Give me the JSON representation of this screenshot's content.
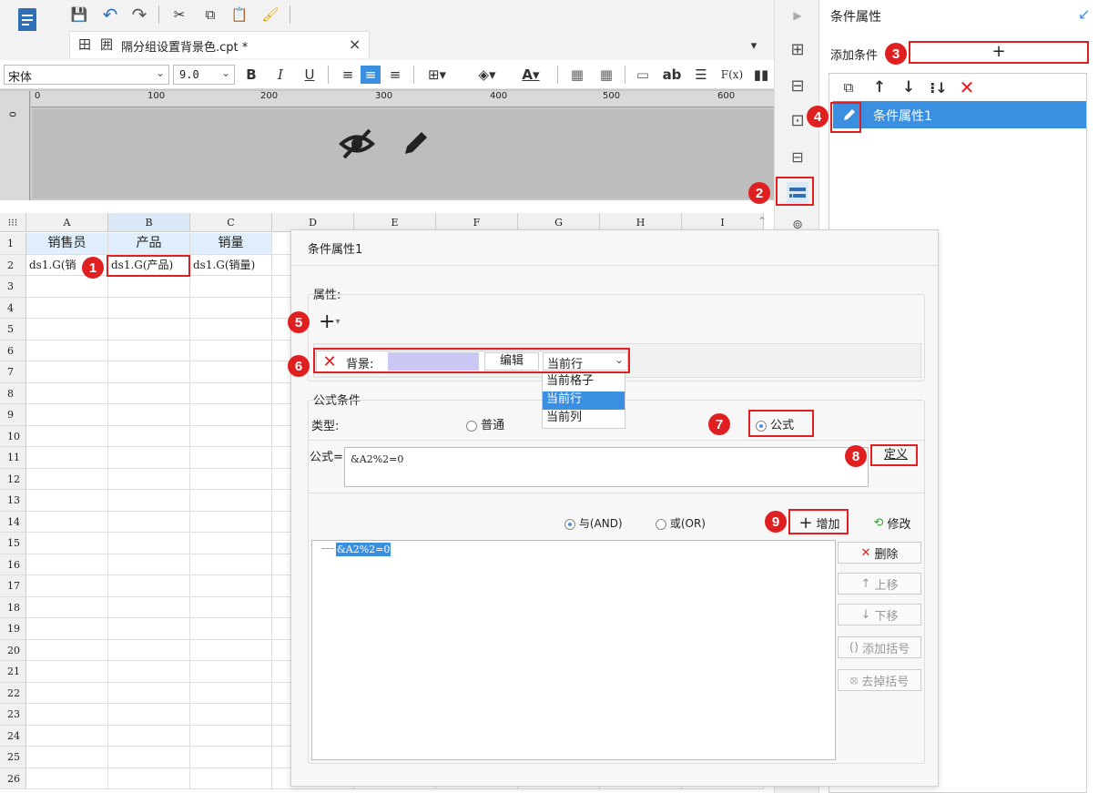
{
  "toolbar": {
    "file_title": "隔分组设置背景色.cpt *",
    "font_name": "宋体",
    "font_size": "9.0",
    "bold": "B",
    "italic": "I",
    "underline": "U",
    "text_btn": "ab",
    "formula_btn": "F(x)",
    "close": "×"
  },
  "ruler": {
    "ticks": [
      "0",
      "100",
      "200",
      "300",
      "400",
      "500",
      "600"
    ],
    "v_zero": "0"
  },
  "grid": {
    "columns": [
      "A",
      "B",
      "C",
      "D",
      "E",
      "F",
      "G",
      "H",
      "I"
    ],
    "rows": [
      "1",
      "2",
      "3",
      "4",
      "5",
      "6",
      "7",
      "8",
      "9",
      "10",
      "11",
      "12",
      "13",
      "14",
      "15",
      "16",
      "17",
      "18",
      "19",
      "20",
      "21",
      "22",
      "23",
      "24",
      "25",
      "26"
    ],
    "header_row": [
      "销售员",
      "产品",
      "销量"
    ],
    "data_row": [
      "ds1.G(销",
      "ds1.G(产品)",
      "ds1.G(销量)"
    ]
  },
  "right_panel": {
    "title": "条件属性",
    "add_condition_label": "添加条件",
    "add_symbol": "+",
    "condition_item": "条件属性1"
  },
  "dialog": {
    "title": "条件属性1",
    "attributes_label": "属性:",
    "add_plus": "+",
    "background_label": "背景:",
    "edit_button": "编辑",
    "scope_selected": "当前行",
    "scope_options": [
      "当前格子",
      "当前行",
      "当前列"
    ],
    "formula_condition_label": "公式条件",
    "type_label": "类型:",
    "type_normal": "普通",
    "type_formula": "公式",
    "formula_label": "公式=",
    "formula_value": "&A2%2=0",
    "define_button": "定义",
    "and_label": "与(AND)",
    "or_label": "或(OR)",
    "add_button": "增加",
    "modify_button": "修改",
    "delete_button": "删除",
    "up_button": "上移",
    "down_button": "下移",
    "add_bracket_button": "添加括号",
    "remove_bracket_button": "去掉括号",
    "condition_list_item": "&A2%2=0"
  },
  "badges": [
    "1",
    "2",
    "3",
    "4",
    "5",
    "6",
    "7",
    "8",
    "9"
  ],
  "colors": {
    "accent": "#3b8fe0",
    "highlight": "#e02020",
    "bg_swatch": "#c9c8f5"
  }
}
